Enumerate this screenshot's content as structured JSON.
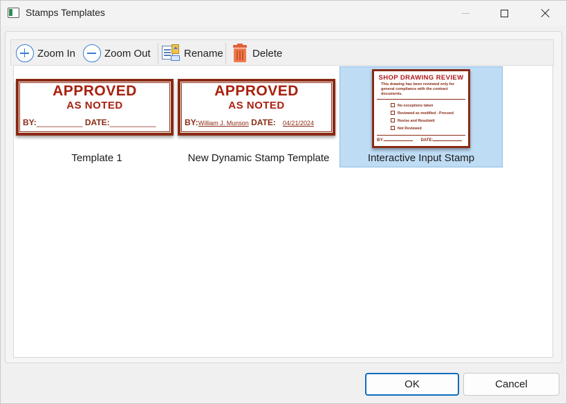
{
  "window": {
    "title": "Stamps Templates"
  },
  "toolbar": {
    "zoom_in": "Zoom In",
    "zoom_out": "Zoom Out",
    "rename": "Rename",
    "delete": "Delete"
  },
  "templates": [
    {
      "label": "Template 1",
      "stamp": {
        "line1": "APPROVED",
        "line2": "AS NOTED",
        "by_label": "BY:",
        "by_value": "__________",
        "date_label": "DATE:",
        "date_value": "__________"
      }
    },
    {
      "label": "New Dynamic Stamp Template",
      "stamp": {
        "line1": "APPROVED",
        "line2": "AS NOTED",
        "by_label": "BY:",
        "by_value": "William J. Munson",
        "date_label": "DATE:",
        "date_value": "04/21/2024"
      }
    },
    {
      "label": "Interactive Input Stamp",
      "selected": true,
      "stamp": {
        "title": "SHOP DRAWING REVIEW",
        "subtitle": "This drawing has been reviewed only for general compliance with the contract documents.",
        "options": [
          "No exceptions taken",
          "Reviewed as modified - Proceed",
          "Revise and Resubmit",
          "Not Reviewed"
        ],
        "by_label": "BY:",
        "date_label": "DATE:"
      }
    }
  ],
  "footer": {
    "ok": "OK",
    "cancel": "Cancel"
  },
  "colors": {
    "stamp_red": "#a8200f",
    "selection": "#bfdcf5",
    "accent": "#0f6cbd"
  }
}
